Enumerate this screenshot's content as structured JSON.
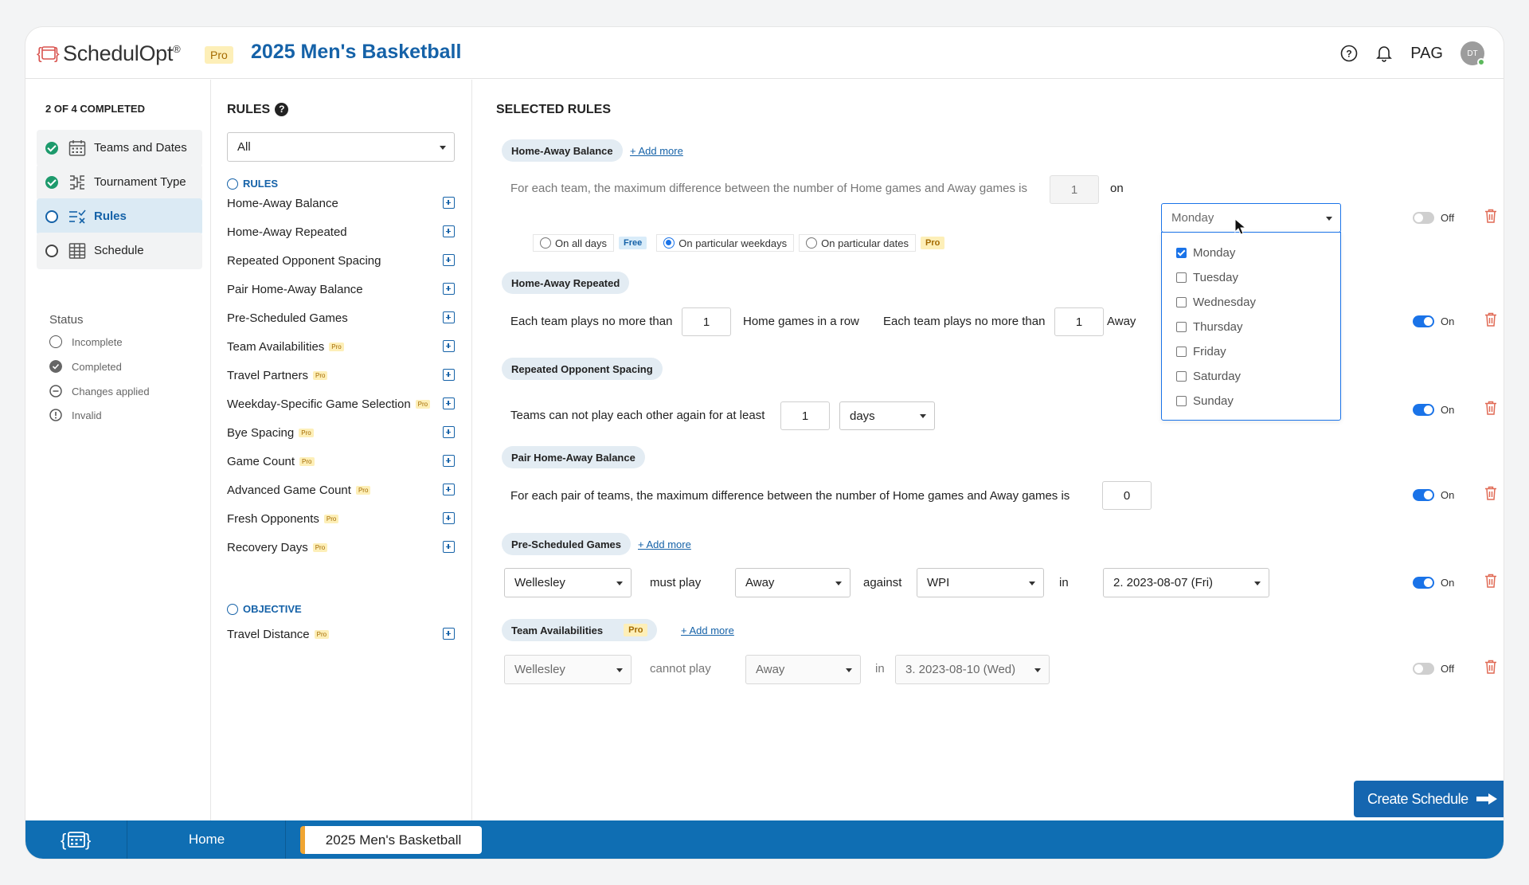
{
  "header": {
    "logo_text": "SchedulOpt",
    "logo_reg": "®",
    "pro_label": "Pro",
    "title": "2025 Men's Basketball",
    "org": "PAG",
    "avatar_initials": "DT"
  },
  "steps": {
    "progress": "2 OF 4 COMPLETED",
    "items": [
      {
        "label": "Teams and Dates",
        "state": "completed",
        "icon": "calendar-icon"
      },
      {
        "label": "Tournament Type",
        "state": "completed",
        "icon": "bracket-icon"
      },
      {
        "label": "Rules",
        "state": "active",
        "icon": "rules-icon"
      },
      {
        "label": "Schedule",
        "state": "incomplete",
        "icon": "table-icon"
      }
    ],
    "status_title": "Status",
    "status": [
      {
        "label": "Incomplete",
        "icon": "circle-icon"
      },
      {
        "label": "Completed",
        "icon": "check-circle-icon"
      },
      {
        "label": "Changes applied",
        "icon": "minus-circle-icon"
      },
      {
        "label": "Invalid",
        "icon": "alert-circle-icon"
      }
    ]
  },
  "rules": {
    "title": "RULES",
    "filter_value": "All",
    "rules_label": "RULES",
    "objective_label": "OBJECTIVE",
    "items": [
      {
        "label": "Home-Away Balance",
        "pro": false
      },
      {
        "label": "Home-Away Repeated",
        "pro": false
      },
      {
        "label": "Repeated Opponent Spacing",
        "pro": false
      },
      {
        "label": "Pair Home-Away Balance",
        "pro": false
      },
      {
        "label": "Pre-Scheduled Games",
        "pro": false
      },
      {
        "label": "Team Availabilities",
        "pro": true
      },
      {
        "label": "Travel Partners",
        "pro": true
      },
      {
        "label": "Weekday-Specific Game Selection",
        "pro": true
      },
      {
        "label": "Bye Spacing",
        "pro": true
      },
      {
        "label": "Game Count",
        "pro": true
      },
      {
        "label": "Advanced Game Count",
        "pro": true
      },
      {
        "label": "Fresh Opponents",
        "pro": true
      },
      {
        "label": "Recovery Days",
        "pro": true
      }
    ],
    "objectives": [
      {
        "label": "Travel Distance",
        "pro": true
      }
    ],
    "pro_mini": "Pro"
  },
  "selected": {
    "title": "SELECTED RULES",
    "add_more": "+ Add more",
    "hab": {
      "pill": "Home-Away Balance",
      "text": "For each team, the maximum difference between the number of Home games and Away games is",
      "value": "1",
      "on_text": "on",
      "weekday": "Monday",
      "opt_all": "On all days",
      "free": "Free",
      "opt_weekdays": "On particular weekdays",
      "opt_dates": "On particular dates",
      "pro": "Pro",
      "toggle": "Off"
    },
    "har": {
      "pill": "Home-Away Repeated",
      "text1": "Each team plays no more than",
      "value1": "1",
      "text2": "Home games in a row",
      "text3": "Each team plays no more than",
      "value2": "1",
      "text4": "Away",
      "toggle": "On"
    },
    "ros": {
      "pill": "Repeated Opponent Spacing",
      "text": "Teams can not play each other again for at least",
      "value": "1",
      "unit": "days",
      "toggle": "On"
    },
    "phab": {
      "pill": "Pair Home-Away Balance",
      "text": "For each pair of teams, the maximum difference between the number of Home games and Away games is",
      "value": "0",
      "toggle": "On"
    },
    "psg": {
      "pill": "Pre-Scheduled Games",
      "team": "Wellesley",
      "must_play": "must play",
      "venue": "Away",
      "against": "against",
      "opponent": "WPI",
      "in": "in",
      "date": "2. 2023-08-07 (Fri)",
      "toggle": "On"
    },
    "ta": {
      "pill": "Team Availabilities",
      "pro": "Pro",
      "team": "Wellesley",
      "cannot_play": "cannot play",
      "venue": "Away",
      "in": "in",
      "date": "3. 2023-08-10 (Wed)",
      "toggle": "Off"
    },
    "weekday_options": [
      {
        "label": "Monday",
        "checked": true
      },
      {
        "label": "Tuesday",
        "checked": false
      },
      {
        "label": "Wednesday",
        "checked": false
      },
      {
        "label": "Thursday",
        "checked": false
      },
      {
        "label": "Friday",
        "checked": false
      },
      {
        "label": "Saturday",
        "checked": false
      },
      {
        "label": "Sunday",
        "checked": false
      }
    ],
    "create_button": "Create Schedule"
  },
  "bottombar": {
    "home": "Home",
    "active_tab": "2025 Men's Basketball"
  },
  "colors": {
    "brand_blue": "#1562a8",
    "toggle_on": "#1a73e8",
    "completed_green": "#1d9a6c",
    "pro_bg": "#fdefb8",
    "delete_red": "#e06a55"
  }
}
